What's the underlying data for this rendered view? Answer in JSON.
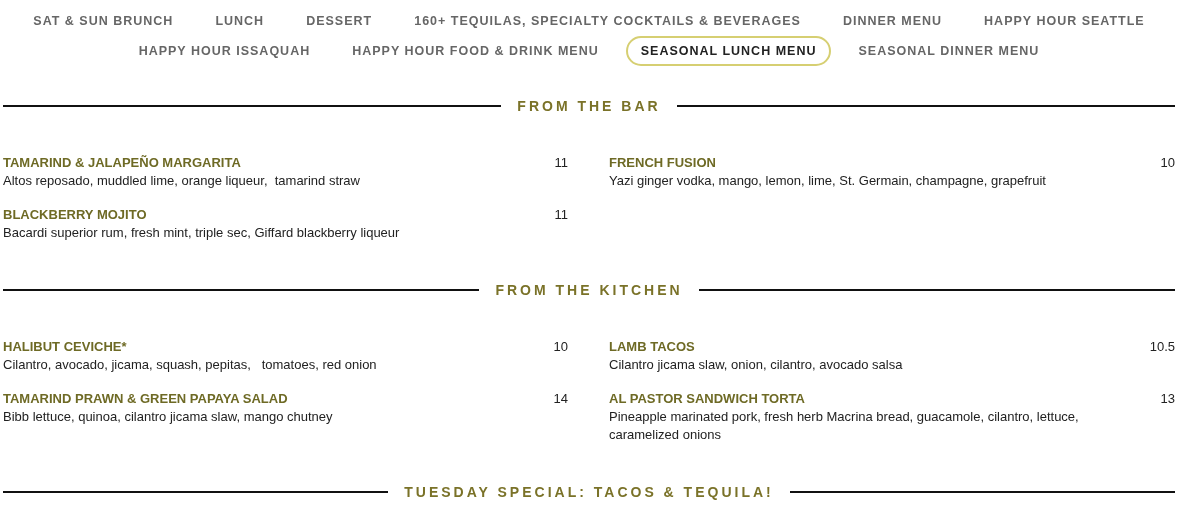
{
  "tab_rows": [
    [
      {
        "label": "SAT & SUN BRUNCH",
        "selected": false
      },
      {
        "label": "LUNCH",
        "selected": false
      },
      {
        "label": "DESSERT",
        "selected": false
      },
      {
        "label": "160+ TEQUILAS, SPECIALTY COCKTAILS & BEVERAGES",
        "selected": false
      },
      {
        "label": "DINNER MENU",
        "selected": false
      },
      {
        "label": "HAPPY HOUR SEATTLE",
        "selected": false
      }
    ],
    [
      {
        "label": "HAPPY HOUR ISSAQUAH",
        "selected": false
      },
      {
        "label": "HAPPY HOUR FOOD & DRINK MENU",
        "selected": false
      },
      {
        "label": "SEASONAL LUNCH MENU",
        "selected": true
      },
      {
        "label": "SEASONAL DINNER MENU",
        "selected": false
      }
    ]
  ],
  "sections": [
    {
      "title": "FROM THE BAR",
      "columns": [
        [
          {
            "name": "TAMARIND & JALAPEÑO MARGARITA",
            "price": "11",
            "description": "Altos reposado, muddled lime, orange liqueur,  tamarind straw"
          },
          {
            "name": "BLACKBERRY MOJITO",
            "price": "11",
            "description": "Bacardi superior rum, fresh mint, triple sec, Giffard blackberry liqueur"
          }
        ],
        [
          {
            "name": "FRENCH FUSION",
            "price": "10",
            "description": "Yazi ginger vodka, mango, lemon, lime, St. Germain, champagne, grapefruit"
          }
        ]
      ]
    },
    {
      "title": "FROM THE KITCHEN",
      "columns": [
        [
          {
            "name": "HALIBUT CEVICHE*",
            "price": "10",
            "description": "Cilantro, avocado, jicama, squash, pepitas,   tomatoes, red onion"
          },
          {
            "name": "TAMARIND PRAWN & GREEN PAPAYA SALAD",
            "price": "14",
            "description": "Bibb lettuce, quinoa, cilantro jicama slaw, mango chutney"
          }
        ],
        [
          {
            "name": "LAMB TACOS",
            "price": "10.5",
            "description": "Cilantro jicama slaw, onion, cilantro, avocado salsa"
          },
          {
            "name": "AL PASTOR SANDWICH TORTA",
            "price": "13",
            "description": "Pineapple marinated pork, fresh herb Macrina bread, guacamole, cilantro, lettuce, caramelized onions"
          }
        ]
      ]
    },
    {
      "title": "TUESDAY SPECIAL: TACOS & TEQUILA!"
    }
  ]
}
